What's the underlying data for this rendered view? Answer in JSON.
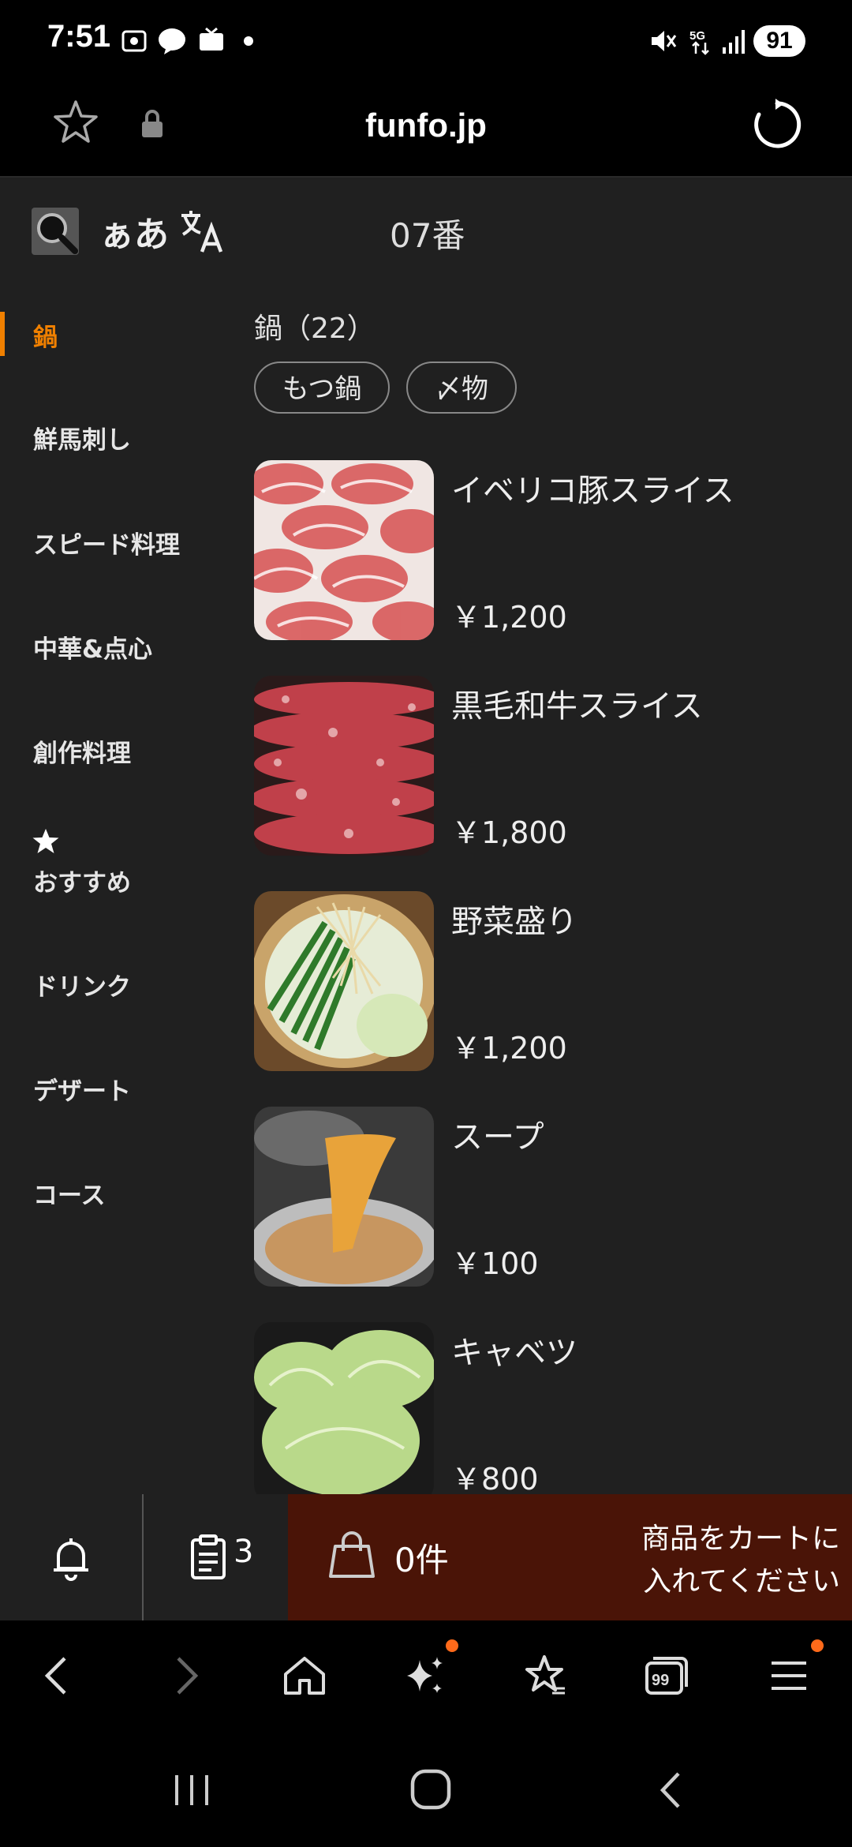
{
  "status_bar": {
    "time": "7:51",
    "battery": "91"
  },
  "browser": {
    "url": "funfo.jp"
  },
  "header": {
    "aa_label": "ぁあ",
    "table_number": "07番"
  },
  "sidebar": {
    "categories": [
      {
        "label": "鍋",
        "active": true
      },
      {
        "label": "鮮馬刺し"
      },
      {
        "label": "スピード料理"
      },
      {
        "label": "中華&点心"
      },
      {
        "label": "創作料理"
      },
      {
        "label": "おすすめ"
      },
      {
        "label": "ドリンク"
      },
      {
        "label": "デザート"
      },
      {
        "label": "コース"
      }
    ]
  },
  "main": {
    "section_title": "鍋（22）",
    "chips": [
      "もつ鍋",
      "〆物"
    ],
    "items": [
      {
        "name": "イベリコ豚スライス",
        "price": "￥1,200"
      },
      {
        "name": "黒毛和牛スライス",
        "price": "￥1,800"
      },
      {
        "name": "野菜盛り",
        "price": "￥1,200"
      },
      {
        "name": "スープ",
        "price": "￥100"
      },
      {
        "name": "キャベツ",
        "price": "￥800"
      }
    ]
  },
  "action_bar": {
    "order_count": "3",
    "cart_count": "0件",
    "cart_message_line1": "商品をカートに",
    "cart_message_line2": "入れてください"
  },
  "colors": {
    "accent": "#f08000",
    "cart_bg": "#4a1407",
    "page_bg": "#202020"
  }
}
